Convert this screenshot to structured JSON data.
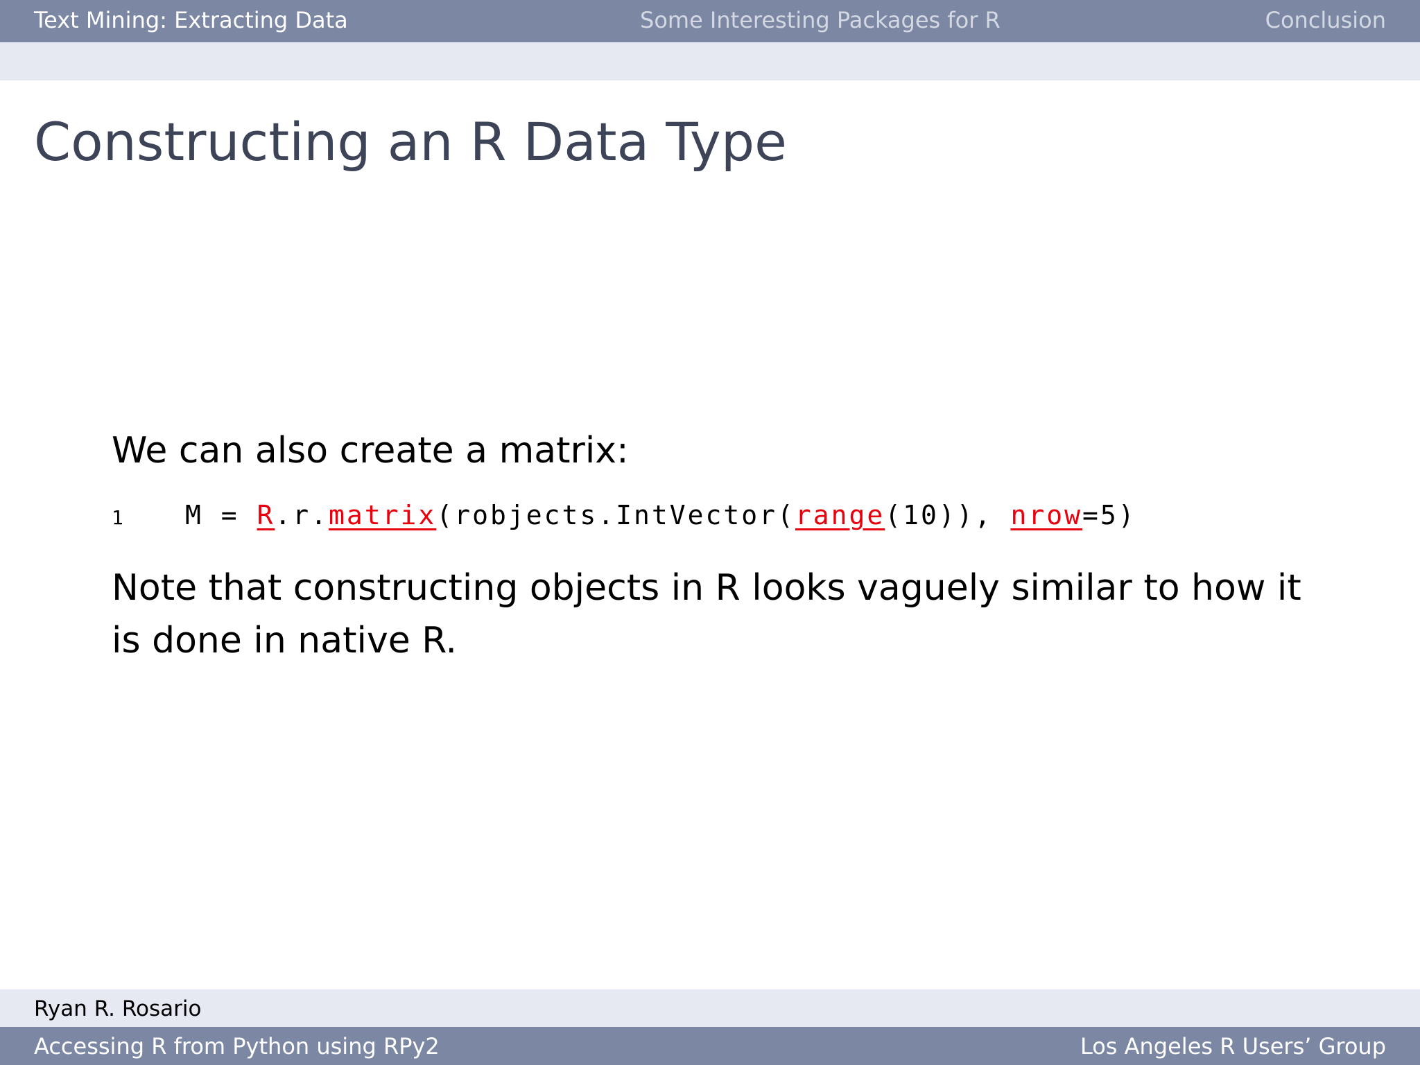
{
  "header": {
    "nav": [
      {
        "label": "Text Mining: Extracting Data",
        "active": true
      },
      {
        "label": "Some Interesting Packages for R",
        "active": false
      },
      {
        "label": "Conclusion",
        "active": false
      }
    ]
  },
  "slide": {
    "title": "Constructing an R Data Type",
    "intro": "We can also create a matrix:",
    "code": {
      "line_number": "1",
      "tokens": [
        {
          "text": "M = ",
          "keyword": false
        },
        {
          "text": "R",
          "keyword": true
        },
        {
          "text": ".r.",
          "keyword": false
        },
        {
          "text": "matrix",
          "keyword": true
        },
        {
          "text": "(robjects.IntVector(",
          "keyword": false
        },
        {
          "text": "range",
          "keyword": true
        },
        {
          "text": "(10)), ",
          "keyword": false
        },
        {
          "text": "nrow",
          "keyword": true
        },
        {
          "text": "=5)",
          "keyword": false
        }
      ]
    },
    "note_lines": [
      "Note that constructing objects in R looks vaguely similar to how it",
      "is done in native R."
    ]
  },
  "footer": {
    "author": "Ryan R. Rosario",
    "talk_title": "Accessing R from Python using RPy2",
    "venue": "Los Angeles R Users’ Group"
  },
  "colors": {
    "bar": "#7b87a3",
    "subbar": "#e6e9f2",
    "title": "#3e4458",
    "keyword": "#e8000d"
  }
}
